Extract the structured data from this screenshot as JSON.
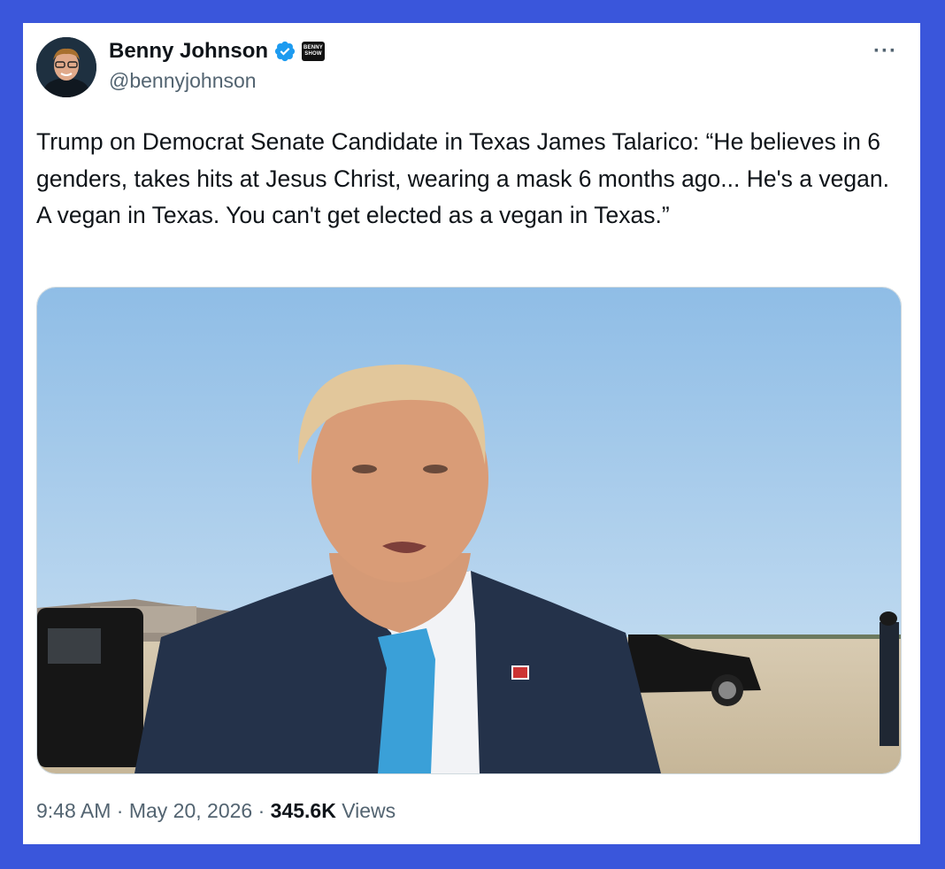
{
  "author": {
    "display_name": "Benny Johnson",
    "handle": "@bennyjohnson",
    "verified": true,
    "affiliate_badge_text": "BENNY SHOW"
  },
  "tweet": {
    "text": "Trump on Democrat Senate Candidate in Texas James Talarico: “He believes in 6 genders, takes hits at Jesus Christ, wearing a mask 6 months ago... He's a vegan. A vegan in Texas. You can't get elected as a vegan in Texas.”",
    "more_icon": "···"
  },
  "meta": {
    "time": "9:48 AM",
    "separator": "·",
    "date": "May 20, 2026",
    "views_count": "345.6K",
    "views_label": "Views"
  },
  "colors": {
    "background": "#3a56db",
    "card": "#ffffff",
    "text": "#0f1419",
    "secondary": "#536471",
    "verified": "#1d9bf0"
  }
}
